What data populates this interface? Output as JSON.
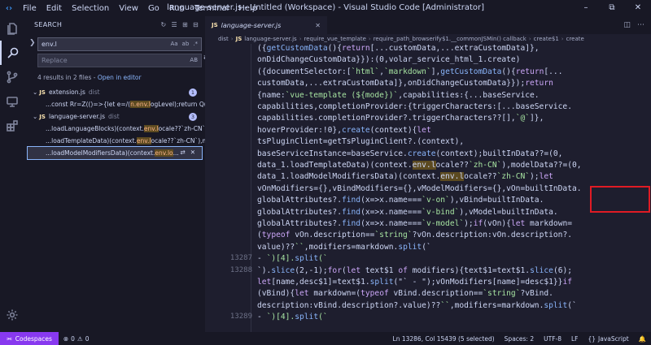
{
  "titlebar": {
    "menu": [
      "File",
      "Edit",
      "Selection",
      "View",
      "Go",
      "Run",
      "Terminal",
      "Help"
    ],
    "title": "language-server.js - Untitled (Workspace) - Visual Studio Code [Administrator]"
  },
  "sidebar": {
    "header": "SEARCH",
    "search_value": "env.l",
    "search_opt_case": "Aa",
    "search_opt_word": "ab",
    "search_opt_regex": ".*",
    "replace_placeholder": "Replace",
    "replace_opt_case": "AB",
    "results_count": "4 results in 2 files - ",
    "open_in_editor": "Open in editor",
    "files": [
      {
        "name": "extension.js",
        "dir": "dist",
        "count": "1",
        "matches": [
          {
            "pre": "...const Rr=Z(()=>{let e=/(",
            "hit": "n.env.l",
            "post": "ogLevel);return Q(n..."
          }
        ]
      },
      {
        "name": "language-server.js",
        "dir": "dist",
        "count": "3",
        "matches": [
          {
            "pre": "...loadLanguageBlocks)(context.",
            "hit": "env.l",
            "post": "ocale??`zh-CN`),..."
          },
          {
            "pre": "...loadTemplateData)(context.",
            "hit": "env.l",
            "post": "ocale??`zh-CN`),mo..."
          },
          {
            "pre": "...loadModelModifiersData)(context.",
            "hit": "env.lo",
            "post": "..."
          }
        ]
      }
    ]
  },
  "editor": {
    "tab_label": "language-server.js",
    "breadcrumb": [
      "dist",
      "language-server.js",
      "require_vue_template",
      "require_path_browserify$1.__commonJSMin() callback",
      "create$1",
      "create"
    ],
    "lines": [
      {
        "ln": "",
        "text": "({getCustomData(){return[...customData,...extraCustomData]},"
      },
      {
        "ln": "",
        "text": "onDidChangeCustomData}}):(0,volar_service_html_1.create)"
      },
      {
        "ln": "",
        "text": "({documentSelector:[`html`,`markdown`],getCustomData(){return[..."
      },
      {
        "ln": "",
        "text": "customData,...extraCustomData]},onDidChangeCustomData}});return"
      },
      {
        "ln": "",
        "text": "{name:`vue-template (${mode})`,capabilities:{...baseService."
      },
      {
        "ln": "",
        "text": "capabilities,completionProvider:{triggerCharacters:[...baseService."
      },
      {
        "ln": "",
        "text": "capabilities.completionProvider?.triggerCharacters??[],`@`]},"
      },
      {
        "ln": "",
        "text": "hoverProvider:!0},create(context){let"
      },
      {
        "ln": "",
        "text": "tsPluginClient=getTsPluginClient?.(context),"
      },
      {
        "ln": "",
        "text": "baseServiceInstance=baseService.create(context);builtInData??=(0,"
      },
      {
        "ln": "",
        "text": "data_1.loadTemplateData)(context.env.locale??`zh-CN`),modelData??=(0,"
      },
      {
        "ln": "",
        "text": "data_1.loadModelModifiersData)(context.env.locale??`zh-CN`);let"
      },
      {
        "ln": "",
        "text": "vOnModifiers={},vBindModifiers={},vModelModifiers={},vOn=builtInData."
      },
      {
        "ln": "",
        "text": "globalAttributes?.find(x=>x.name===`v-on`),vBind=builtInData."
      },
      {
        "ln": "",
        "text": "globalAttributes?.find(x=>x.name===`v-bind`),vModel=builtInData."
      },
      {
        "ln": "",
        "text": "globalAttributes?.find(x=>x.name===`v-model`);if(vOn){let markdown="
      },
      {
        "ln": "",
        "text": "(typeof vOn.description==`string`?vOn.description:vOn.description?."
      },
      {
        "ln": "",
        "text": "value)??``,modifiers=markdown.split(`"
      },
      {
        "ln": "13287",
        "text": "- `)[4].split(`"
      },
      {
        "ln": "13288",
        "text": "`).slice(2,-1);for(let text$1 of modifiers){text$1=text$1.slice(6);"
      },
      {
        "ln": "",
        "text": "let[name,desc$1]=text$1.split(\"` - \");vOnModifiers[name]=desc$1}}if"
      },
      {
        "ln": "",
        "text": "(vBind){let markdown=(typeof vBind.description==`string`?vBind."
      },
      {
        "ln": "",
        "text": "description:vBind.description?.value)??``,modifiers=markdown.split(`"
      },
      {
        "ln": "13289",
        "text": "- `)[4].split(`"
      }
    ]
  },
  "statusbar": {
    "remote": "Codespaces",
    "errors": "0",
    "warnings": "0",
    "position": "Ln 13286, Col 15439 (5 selected)",
    "spaces": "Spaces: 2",
    "encoding": "UTF-8",
    "eol": "LF",
    "language": "JavaScript"
  },
  "colors": {
    "accent": "#8839ef",
    "highlight_box": "#e01b24",
    "match_bg": "#5c4a20"
  }
}
